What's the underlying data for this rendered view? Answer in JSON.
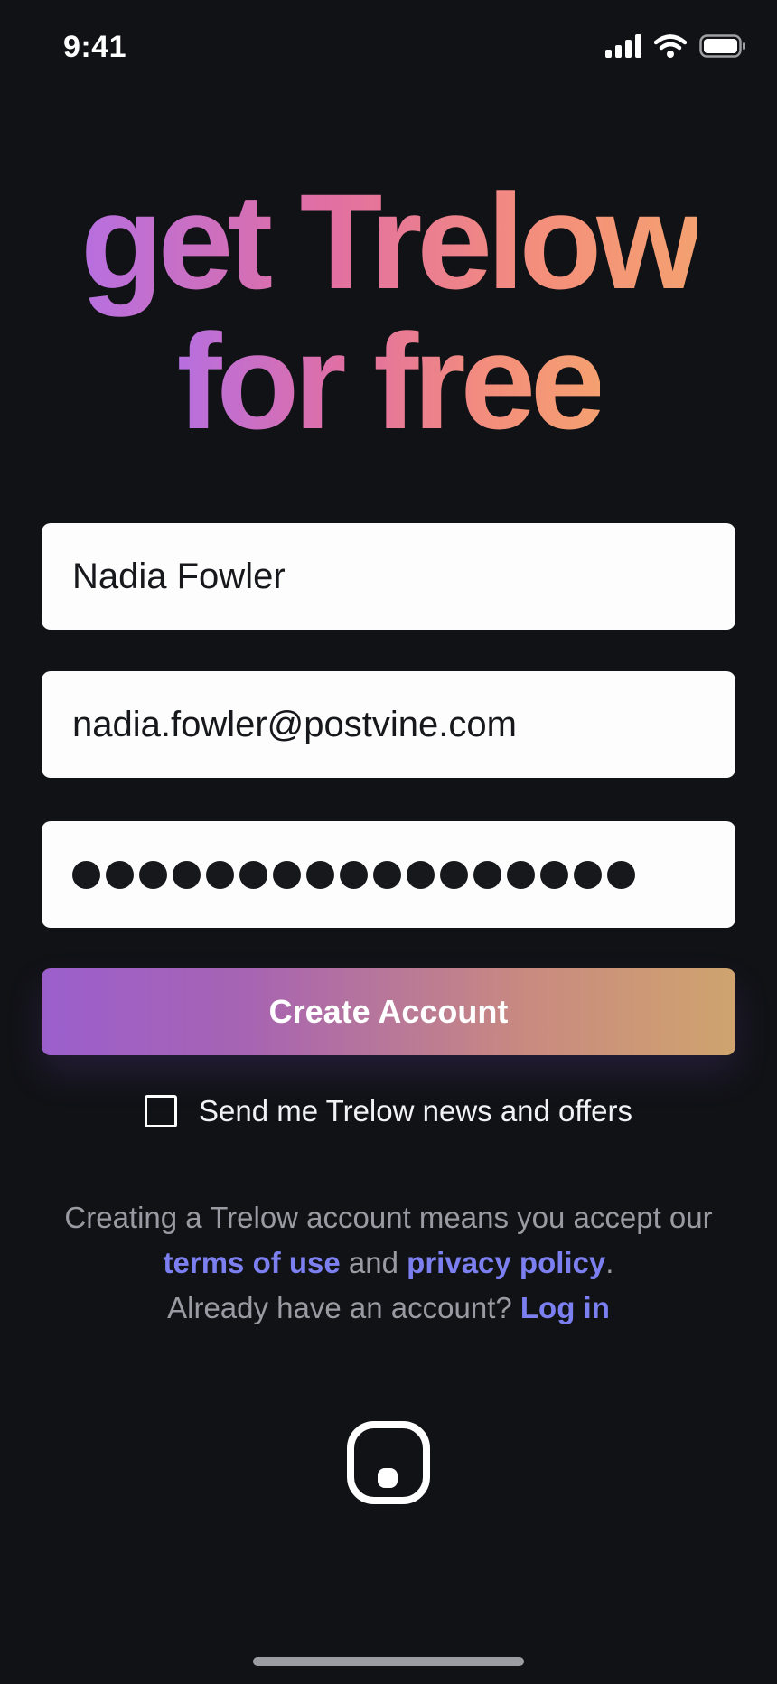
{
  "status_bar": {
    "time": "9:41",
    "icons": [
      "cellular-signal-icon",
      "wifi-icon",
      "battery-icon"
    ]
  },
  "headline": {
    "line1": "get Trelow",
    "line2": "for free",
    "gradient_colors": [
      "#b66fe0",
      "#e26fa2",
      "#f48f7b",
      "#f4a070"
    ]
  },
  "form": {
    "name_value": "Nadia Fowler",
    "email_value": "nadia.fowler@postvine.com",
    "password_length": 17,
    "submit_label": "Create Account"
  },
  "newsletter": {
    "label": "Send me Trelow news and offers",
    "checked": false
  },
  "legal": {
    "line1": "Creating a Trelow account means you accept our",
    "terms_link": "terms of use",
    "and_text": " and ",
    "privacy_link": "privacy policy",
    "period": ".",
    "login_prompt": "Already have an account? ",
    "login_link": "Log in",
    "link_color": "#7b7ff0"
  },
  "logo": {
    "icon": "trelow-logo-icon"
  },
  "colors": {
    "background": "#111216",
    "button_gradient": [
      "#9b5fcd",
      "#cfa46e"
    ]
  }
}
